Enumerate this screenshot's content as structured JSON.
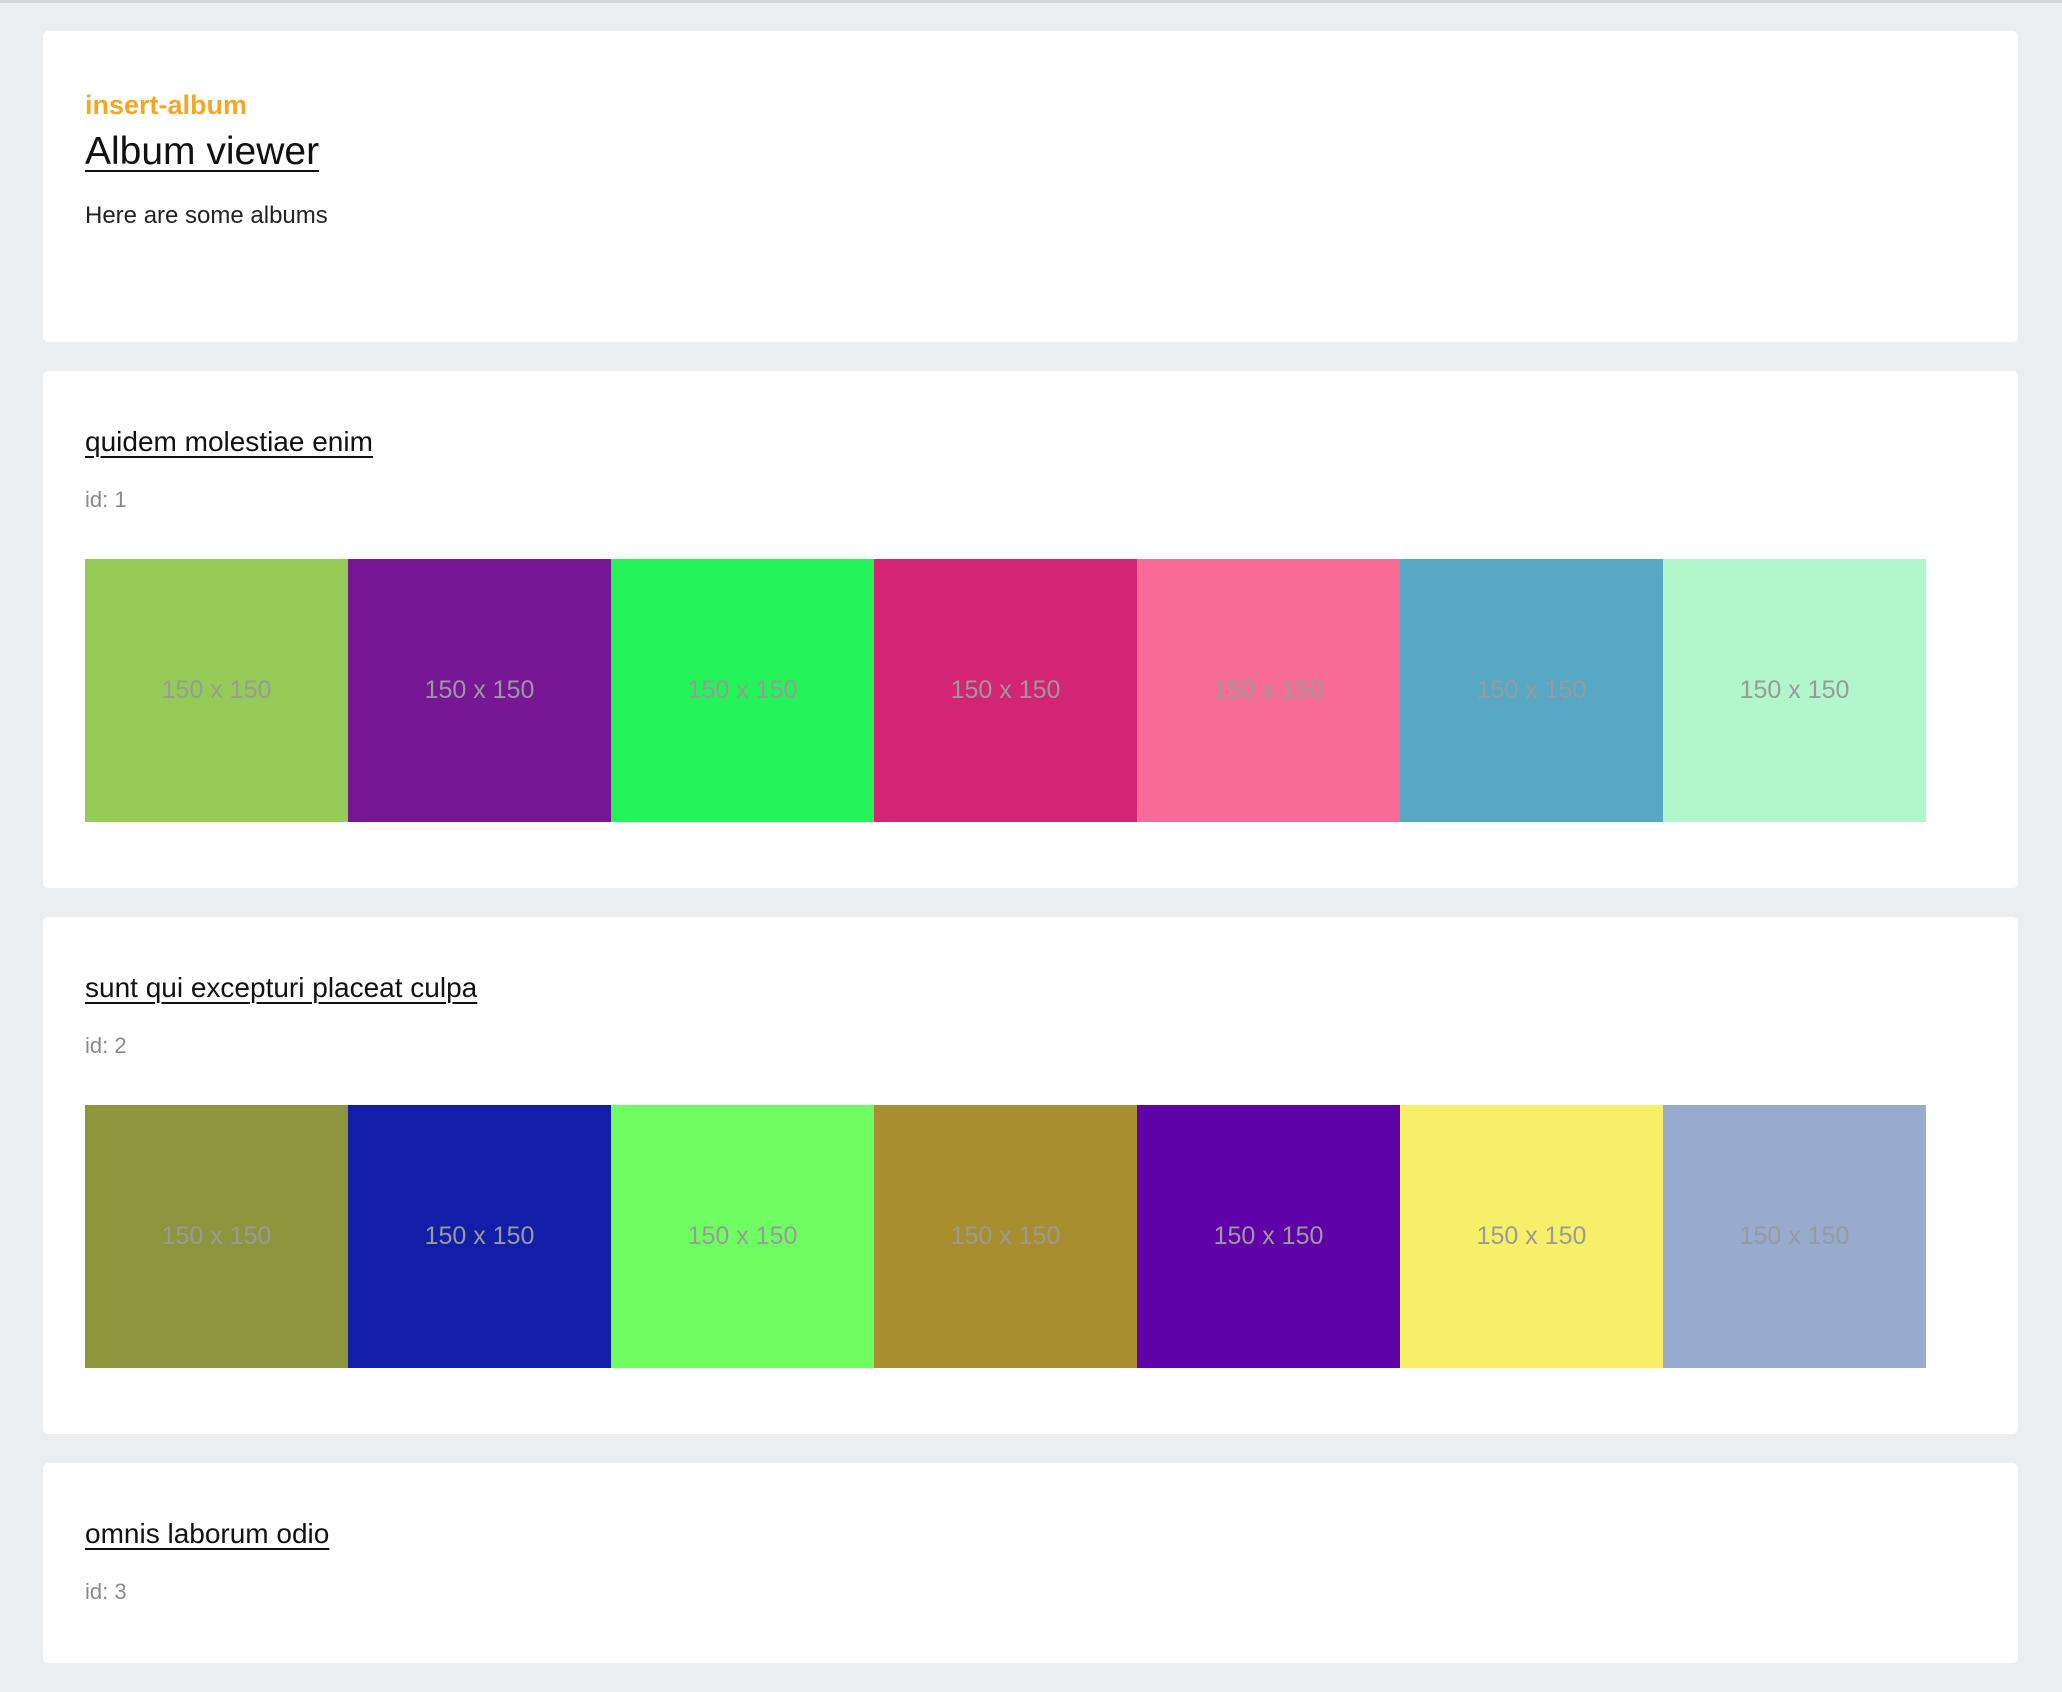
{
  "header": {
    "tag": "insert-album",
    "title": "Album viewer",
    "intro": "Here are some albums"
  },
  "albums": [
    {
      "title": "quidem molestiae enim",
      "id_label": "id: 1",
      "photos": [
        {
          "label": "150 x 150",
          "color": "#95ca56"
        },
        {
          "label": "150 x 150",
          "color": "#771796"
        },
        {
          "label": "150 x 150",
          "color": "#24f45a"
        },
        {
          "label": "150 x 150",
          "color": "#d32573"
        },
        {
          "label": "150 x 150",
          "color": "#f66b97"
        },
        {
          "label": "150 x 150",
          "color": "#56a8c4"
        },
        {
          "label": "150 x 150",
          "color": "#b0f7cb"
        }
      ]
    },
    {
      "title": "sunt qui excepturi placeat culpa",
      "id_label": "id: 2",
      "photos": [
        {
          "label": "150 x 150",
          "color": "#8e963d"
        },
        {
          "label": "150 x 150",
          "color": "#121ea8"
        },
        {
          "label": "150 x 150",
          "color": "#6ffe62"
        },
        {
          "label": "150 x 150",
          "color": "#a98e30"
        },
        {
          "label": "150 x 150",
          "color": "#5f03a8"
        },
        {
          "label": "150 x 150",
          "color": "#f8ef68"
        },
        {
          "label": "150 x 150",
          "color": "#96abcd"
        }
      ]
    },
    {
      "title": "omnis laborum odio",
      "id_label": "id: 3",
      "photos": []
    }
  ]
}
